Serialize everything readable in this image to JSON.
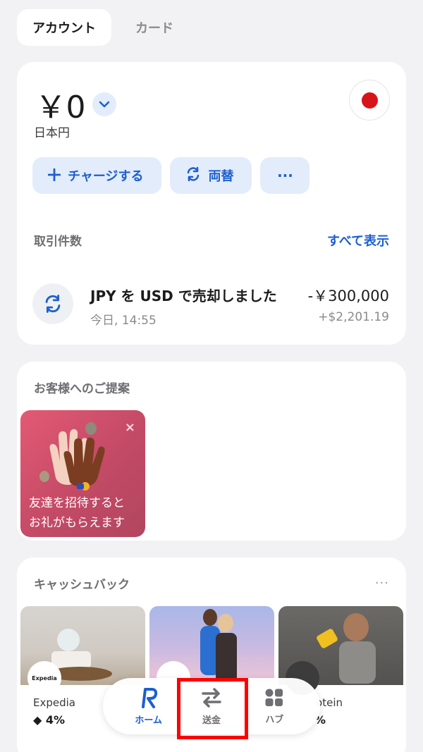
{
  "tabs": [
    {
      "label": "アカウント",
      "active": true
    },
    {
      "label": "カード",
      "active": false
    }
  ],
  "account": {
    "balance": "￥0",
    "currency_name": "日本円",
    "flag_icon": "japan-flag-icon",
    "actions": [
      {
        "label": "チャージする",
        "icon": "plus-icon"
      },
      {
        "label": "両替",
        "icon": "exchange-icon"
      },
      {
        "label": "···",
        "icon": "more-icon"
      }
    ]
  },
  "transactions": {
    "title": "取引件数",
    "see_all": "すべて表示",
    "items": [
      {
        "title": "JPY を USD で売却しました",
        "time": "今日, 14:55",
        "amount": "-￥300,000",
        "sub_amount": "+$2,201.19",
        "icon": "exchange-icon"
      }
    ]
  },
  "suggestions": {
    "title": "お客様へのご提案",
    "promo": {
      "text_line1": "友達を招待すると",
      "text_line2": "お礼がもらえます",
      "close": "×"
    }
  },
  "cashback": {
    "title": "キャッシュバック",
    "menu": "···",
    "tiles": [
      {
        "name": "Expedia",
        "rate": "4%",
        "badge": "Expedia"
      },
      {
        "name": "",
        "rate": "",
        "badge": ""
      },
      {
        "name": "otein",
        "rate": "%",
        "badge": ""
      }
    ]
  },
  "bottom_nav": [
    {
      "label": "ホーム",
      "icon": "revolut-r-icon",
      "active": true
    },
    {
      "label": "送金",
      "icon": "transfer-arrows-icon",
      "active": false
    },
    {
      "label": "ハブ",
      "icon": "grid-icon",
      "active": false
    }
  ],
  "colors": {
    "accent": "#1d5fcf",
    "highlight": "#ff0000",
    "promo": "#d45570"
  }
}
